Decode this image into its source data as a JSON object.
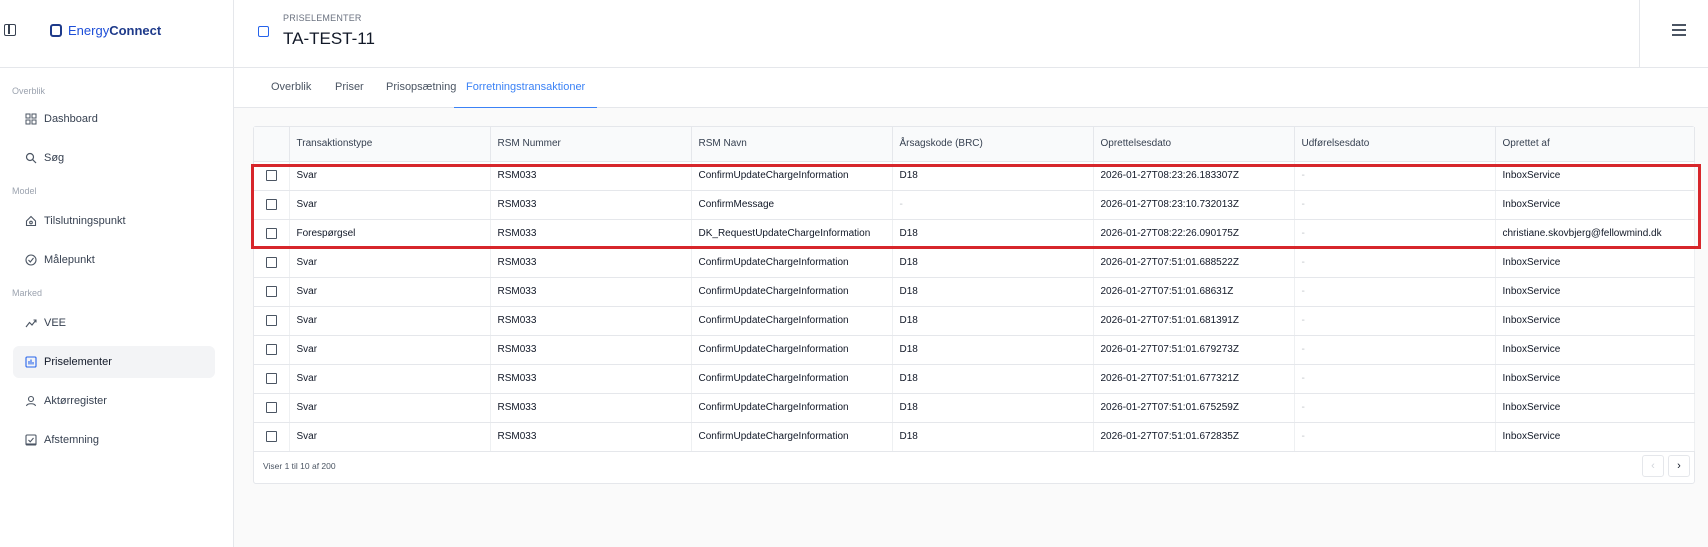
{
  "brand": {
    "prefix": "Energy",
    "suffix": "Connect"
  },
  "sidebar": {
    "sections": [
      "Overblik",
      "Model",
      "Marked"
    ],
    "items": [
      {
        "label": "Dashboard",
        "icon": "dashboard-grid-icon"
      },
      {
        "label": "Søg",
        "icon": "search-icon"
      },
      {
        "label": "Tilslutningspunkt",
        "icon": "home-icon"
      },
      {
        "label": "Målepunkt",
        "icon": "gauge-icon"
      },
      {
        "label": "VEE",
        "icon": "trend-icon"
      },
      {
        "label": "Priselementer",
        "icon": "bar-chart-icon",
        "active": true
      },
      {
        "label": "Aktørregister",
        "icon": "user-icon"
      },
      {
        "label": "Afstemning",
        "icon": "check-chart-icon"
      }
    ]
  },
  "header": {
    "eyebrow": "PRISELEMENTER",
    "title": "TA-TEST-11"
  },
  "tabs": [
    {
      "label": "Overblik"
    },
    {
      "label": "Priser"
    },
    {
      "label": "Prisopsætning"
    },
    {
      "label": "Forretningstransaktioner",
      "active": true
    }
  ],
  "table": {
    "columns": [
      "Transaktionstype",
      "RSM Nummer",
      "RSM Navn",
      "Årsagskode (BRC)",
      "Oprettelsesdato",
      "Udførelsesdato",
      "Oprettet af"
    ],
    "rows": [
      [
        "Svar",
        "RSM033",
        "ConfirmUpdateChargeInformation",
        "D18",
        "2026-01-27T08:23:26.183307Z",
        "-",
        "InboxService"
      ],
      [
        "Svar",
        "RSM033",
        "ConfirmMessage",
        "-",
        "2026-01-27T08:23:10.732013Z",
        "-",
        "InboxService"
      ],
      [
        "Forespørgsel",
        "RSM033",
        "DK_RequestUpdateChargeInformation",
        "D18",
        "2026-01-27T08:22:26.090175Z",
        "-",
        "christiane.skovbjerg@fellowmind.dk"
      ],
      [
        "Svar",
        "RSM033",
        "ConfirmUpdateChargeInformation",
        "D18",
        "2026-01-27T07:51:01.688522Z",
        "-",
        "InboxService"
      ],
      [
        "Svar",
        "RSM033",
        "ConfirmUpdateChargeInformation",
        "D18",
        "2026-01-27T07:51:01.68631Z",
        "-",
        "InboxService"
      ],
      [
        "Svar",
        "RSM033",
        "ConfirmUpdateChargeInformation",
        "D18",
        "2026-01-27T07:51:01.681391Z",
        "-",
        "InboxService"
      ],
      [
        "Svar",
        "RSM033",
        "ConfirmUpdateChargeInformation",
        "D18",
        "2026-01-27T07:51:01.679273Z",
        "-",
        "InboxService"
      ],
      [
        "Svar",
        "RSM033",
        "ConfirmUpdateChargeInformation",
        "D18",
        "2026-01-27T07:51:01.677321Z",
        "-",
        "InboxService"
      ],
      [
        "Svar",
        "RSM033",
        "ConfirmUpdateChargeInformation",
        "D18",
        "2026-01-27T07:51:01.675259Z",
        "-",
        "InboxService"
      ],
      [
        "Svar",
        "RSM033",
        "ConfirmUpdateChargeInformation",
        "D18",
        "2026-01-27T07:51:01.672835Z",
        "-",
        "InboxService"
      ]
    ],
    "footer": "Viser 1 til 10 af 200",
    "prev_icon": "‹",
    "next_icon": "›"
  },
  "colors": {
    "accent": "#3b82f6",
    "highlight": "#d7262b"
  }
}
